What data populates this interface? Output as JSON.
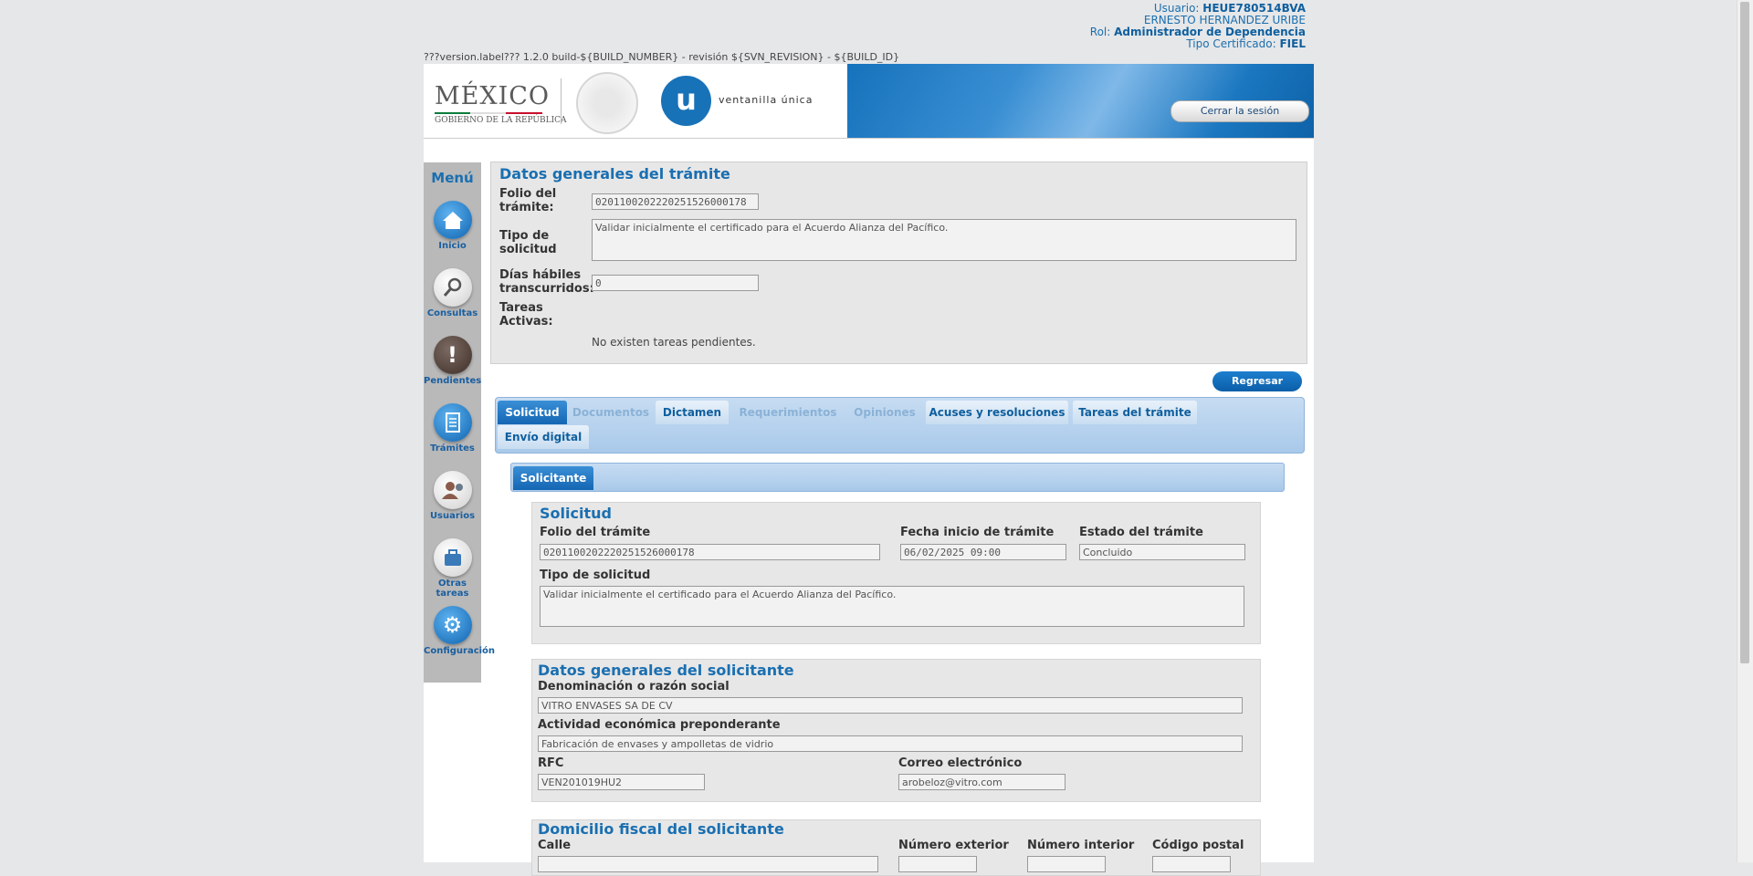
{
  "user": {
    "usuario_label": "Usuario:",
    "usuario": "HEUE780514BVA",
    "name": "ERNESTO HERNANDEZ URIBE",
    "rol_label": "Rol:",
    "rol": "Administrador de Dependencia",
    "cert_label": "Tipo Certificado:",
    "cert": "FIEL"
  },
  "version": "???version.label??? 1.2.0 build-${BUILD_NUMBER} - revisión ${SVN_REVISION} - ${BUILD_ID}",
  "banner": {
    "mexico": "MÉXICO",
    "gobierno": "GOBIERNO DE LA REPÚBLICA",
    "u_letter": "u",
    "vu": "ventanilla única",
    "logout": "Cerrar la sesión"
  },
  "menu": {
    "title": "Menú",
    "items": [
      {
        "label": "Inicio",
        "icon": "home-icon"
      },
      {
        "label": "Consultas",
        "icon": "search-icon"
      },
      {
        "label": "Pendientes",
        "icon": "exclamation-icon"
      },
      {
        "label": "Trámites",
        "icon": "document-icon"
      },
      {
        "label": "Usuarios",
        "icon": "users-icon"
      },
      {
        "label": "Otras tareas",
        "icon": "briefcase-icon"
      },
      {
        "label": "Configuración",
        "icon": "gear-icon"
      }
    ]
  },
  "general": {
    "title": "Datos generales del trámite",
    "folio_label": "Folio del trámite:",
    "folio": "0201100202220251526000178",
    "tipo_label": "Tipo de solicitud",
    "tipo": "Validar  inicialmente  el certificado para el Acuerdo Alianza del Pacífico.",
    "dias_label": "Días hábiles transcurridos:",
    "dias": "0",
    "tareas_label": "Tareas Activas:",
    "pending": "No existen tareas pendientes."
  },
  "regresar": "Regresar",
  "tabs": [
    {
      "label": "Solicitud",
      "state": "active"
    },
    {
      "label": "Documentos",
      "state": "disabled"
    },
    {
      "label": "Dictamen",
      "state": "normal"
    },
    {
      "label": "Requerimientos",
      "state": "disabled"
    },
    {
      "label": "Opiniones",
      "state": "disabled"
    },
    {
      "label": "Acuses y resoluciones",
      "state": "normal"
    },
    {
      "label": "Tareas del trámite",
      "state": "normal"
    },
    {
      "label": "Envío digital",
      "state": "normal"
    }
  ],
  "subtab": "Solicitante",
  "solicitud": {
    "title": "Solicitud",
    "folio_label": "Folio del trámite",
    "folio": "0201100202220251526000178",
    "fecha_label": "Fecha inicio de trámite",
    "fecha": "06/02/2025 09:00",
    "estado_label": "Estado del trámite",
    "estado": "Concluido",
    "tipo_label": "Tipo de solicitud",
    "tipo": "Validar  inicialmente  el certificado para el Acuerdo Alianza del Pacífico."
  },
  "solicitante": {
    "title": "Datos generales del solicitante",
    "denominacion_label": "Denominación o razón social",
    "denominacion": "VITRO ENVASES SA DE CV",
    "actividad_label": "Actividad económica preponderante",
    "actividad": "Fabricación de envases y ampolletas de vidrio",
    "rfc_label": "RFC",
    "rfc": "VEN201019HU2",
    "correo_label": "Correo electrónico",
    "correo": "arobeloz@vitro.com"
  },
  "domicilio": {
    "title": "Domicilio fiscal del solicitante",
    "calle_label": "Calle",
    "num_ext_label": "Número exterior",
    "num_int_label": "Número interior",
    "cp_label": "Código postal"
  }
}
